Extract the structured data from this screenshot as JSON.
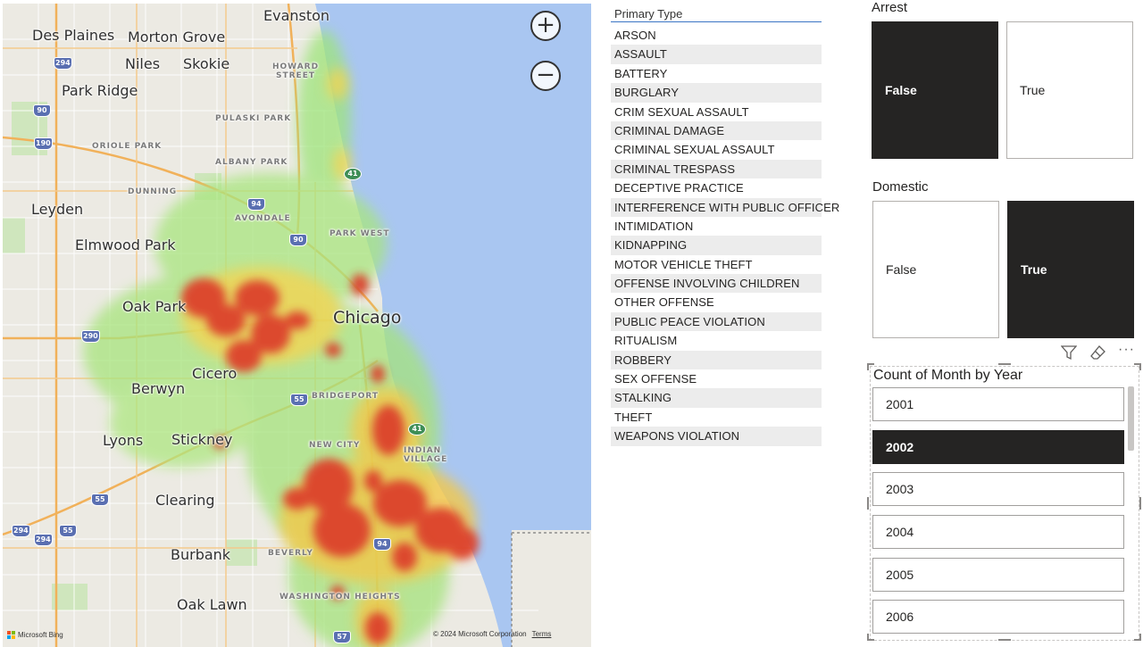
{
  "map": {
    "zoom_in_label": "+",
    "zoom_out_label": "−",
    "attribution": "© 2024 Microsoft Corporation",
    "terms": "Terms",
    "provider": "Microsoft Bing",
    "places": {
      "evanston": "Evanston",
      "des_plaines": "Des Plaines",
      "morton_grove": "Morton Grove",
      "niles": "Niles",
      "skokie": "Skokie",
      "park_ridge": "Park Ridge",
      "howard_street": "HOWARD STREET",
      "pulaski_park": "PULASKI PARK",
      "oriole_park": "ORIOLE PARK",
      "albany_park": "ALBANY PARK",
      "dunning": "DUNNING",
      "leyden": "Leyden",
      "avondale": "AVONDALE",
      "park_west": "PARK WEST",
      "elmwood_park": "Elmwood Park",
      "oak_park": "Oak Park",
      "chicago": "Chicago",
      "cicero": "Cicero",
      "berwyn": "Berwyn",
      "bridgeport": "BRIDGEPORT",
      "lyons": "Lyons",
      "stickney": "Stickney",
      "new_city": "NEW CITY",
      "indian_village": "INDIAN VILLAGE",
      "clearing": "Clearing",
      "burbank": "Burbank",
      "beverly": "BEVERLY",
      "washington_heights": "WASHINGTON HEIGHTS",
      "oak_lawn": "Oak Lawn"
    },
    "shields": [
      "294",
      "90",
      "190",
      "94",
      "90",
      "41",
      "290",
      "55",
      "41",
      "55",
      "294",
      "294",
      "55",
      "94",
      "57"
    ]
  },
  "primary_type": {
    "header": "Primary Type",
    "items": [
      "ARSON",
      "ASSAULT",
      "BATTERY",
      "BURGLARY",
      "CRIM SEXUAL ASSAULT",
      "CRIMINAL DAMAGE",
      "CRIMINAL SEXUAL ASSAULT",
      "CRIMINAL TRESPASS",
      "DECEPTIVE PRACTICE",
      "INTERFERENCE WITH PUBLIC OFFICER",
      "INTIMIDATION",
      "KIDNAPPING",
      "MOTOR VEHICLE THEFT",
      "OFFENSE INVOLVING CHILDREN",
      "OTHER OFFENSE",
      "PUBLIC PEACE VIOLATION",
      "RITUALISM",
      "ROBBERY",
      "SEX OFFENSE",
      "STALKING",
      "THEFT",
      "WEAPONS VIOLATION"
    ]
  },
  "arrest": {
    "title": "Arrest",
    "options": [
      {
        "label": "False",
        "selected": true
      },
      {
        "label": "True",
        "selected": false
      }
    ]
  },
  "domestic": {
    "title": "Domestic",
    "options": [
      {
        "label": "False",
        "selected": false
      },
      {
        "label": "True",
        "selected": true
      }
    ]
  },
  "year_slicer": {
    "title": "Count of Month by Year",
    "items": [
      {
        "label": "2001",
        "selected": false
      },
      {
        "label": "2002",
        "selected": true
      },
      {
        "label": "2003",
        "selected": false
      },
      {
        "label": "2004",
        "selected": false
      },
      {
        "label": "2005",
        "selected": false
      },
      {
        "label": "2006",
        "selected": false
      }
    ],
    "icons": [
      "filter-icon",
      "eraser-icon",
      "more-options-icon"
    ]
  },
  "colors": {
    "selected": "#252423",
    "water": "#aac8f2",
    "heat_hot": "#dc3c2c",
    "heat_mid": "#f3c84a",
    "heat_low": "#9ee47a"
  }
}
